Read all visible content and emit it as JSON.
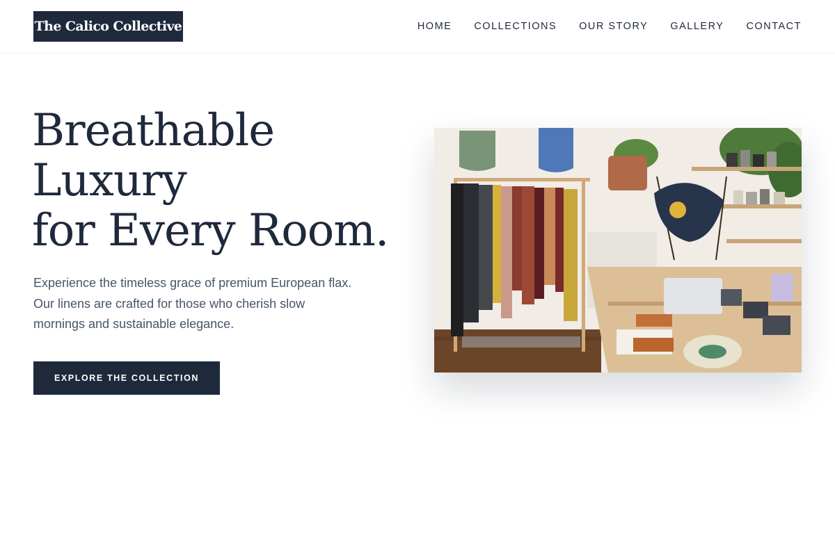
{
  "brand": {
    "name": "The Calico Collective"
  },
  "nav": {
    "items": [
      {
        "label": "HOME"
      },
      {
        "label": "COLLECTIONS"
      },
      {
        "label": "OUR STORY"
      },
      {
        "label": "GALLERY"
      },
      {
        "label": "CONTACT"
      }
    ]
  },
  "hero": {
    "title_lines": [
      "Breathable",
      "Luxury",
      "for Every Room."
    ],
    "description": "Experience the timeless grace of premium European flax. Our linens are crafted for those who cherish slow mornings and sustainable elegance.",
    "cta_label": "EXPLORE THE COLLECTION"
  },
  "colors": {
    "primary": "#1e293b",
    "body_text": "#475569",
    "background": "#ffffff"
  }
}
